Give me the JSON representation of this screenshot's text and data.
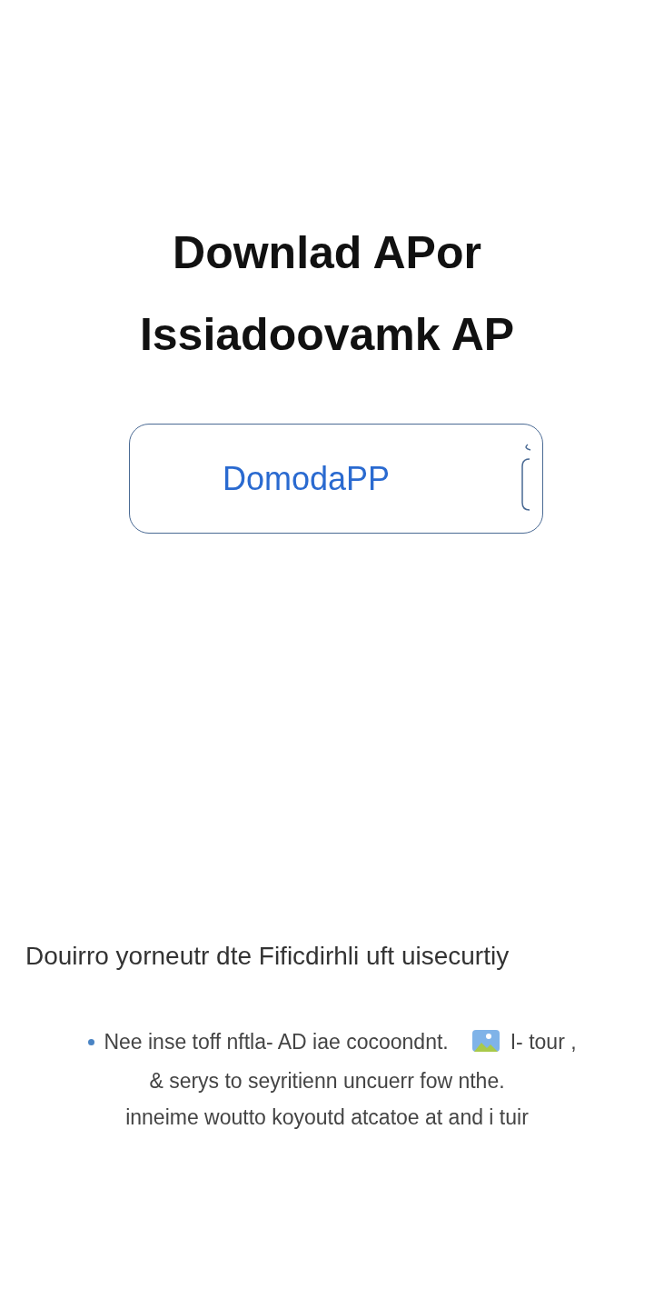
{
  "title_lines": [
    "Downlad APor",
    "Issiadoovamk AP"
  ],
  "download_button": {
    "label": "DomodaPP"
  },
  "section_heading": "Douirro yorneutr dte Fificdirhli uft uisecurtiy",
  "bullet": {
    "text_before_icon": "Nee inse toff nftla- AD iae cocoondnt.",
    "text_after_icon": "I- tour ,",
    "lines": [
      "& serys to seyritienn uncuerr fow nthe.",
      "inneime wouttо koyoutd atcatoe at and i tuir"
    ]
  }
}
